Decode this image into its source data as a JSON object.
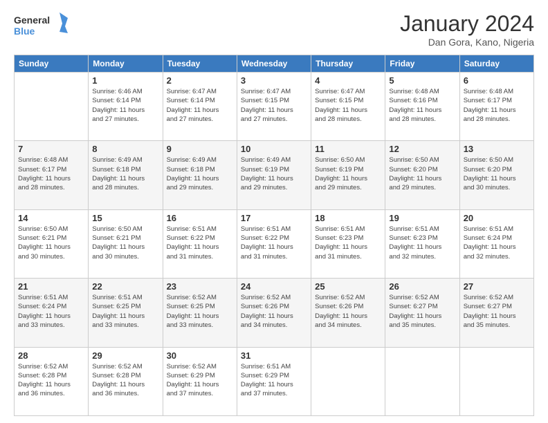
{
  "header": {
    "logo_general": "General",
    "logo_blue": "Blue",
    "month_title": "January 2024",
    "location": "Dan Gora, Kano, Nigeria"
  },
  "days_of_week": [
    "Sunday",
    "Monday",
    "Tuesday",
    "Wednesday",
    "Thursday",
    "Friday",
    "Saturday"
  ],
  "weeks": [
    [
      {
        "day": "",
        "info": ""
      },
      {
        "day": "1",
        "info": "Sunrise: 6:46 AM\nSunset: 6:14 PM\nDaylight: 11 hours\nand 27 minutes."
      },
      {
        "day": "2",
        "info": "Sunrise: 6:47 AM\nSunset: 6:14 PM\nDaylight: 11 hours\nand 27 minutes."
      },
      {
        "day": "3",
        "info": "Sunrise: 6:47 AM\nSunset: 6:15 PM\nDaylight: 11 hours\nand 27 minutes."
      },
      {
        "day": "4",
        "info": "Sunrise: 6:47 AM\nSunset: 6:15 PM\nDaylight: 11 hours\nand 28 minutes."
      },
      {
        "day": "5",
        "info": "Sunrise: 6:48 AM\nSunset: 6:16 PM\nDaylight: 11 hours\nand 28 minutes."
      },
      {
        "day": "6",
        "info": "Sunrise: 6:48 AM\nSunset: 6:17 PM\nDaylight: 11 hours\nand 28 minutes."
      }
    ],
    [
      {
        "day": "7",
        "info": "Sunrise: 6:48 AM\nSunset: 6:17 PM\nDaylight: 11 hours\nand 28 minutes."
      },
      {
        "day": "8",
        "info": "Sunrise: 6:49 AM\nSunset: 6:18 PM\nDaylight: 11 hours\nand 28 minutes."
      },
      {
        "day": "9",
        "info": "Sunrise: 6:49 AM\nSunset: 6:18 PM\nDaylight: 11 hours\nand 29 minutes."
      },
      {
        "day": "10",
        "info": "Sunrise: 6:49 AM\nSunset: 6:19 PM\nDaylight: 11 hours\nand 29 minutes."
      },
      {
        "day": "11",
        "info": "Sunrise: 6:50 AM\nSunset: 6:19 PM\nDaylight: 11 hours\nand 29 minutes."
      },
      {
        "day": "12",
        "info": "Sunrise: 6:50 AM\nSunset: 6:20 PM\nDaylight: 11 hours\nand 29 minutes."
      },
      {
        "day": "13",
        "info": "Sunrise: 6:50 AM\nSunset: 6:20 PM\nDaylight: 11 hours\nand 30 minutes."
      }
    ],
    [
      {
        "day": "14",
        "info": "Sunrise: 6:50 AM\nSunset: 6:21 PM\nDaylight: 11 hours\nand 30 minutes."
      },
      {
        "day": "15",
        "info": "Sunrise: 6:50 AM\nSunset: 6:21 PM\nDaylight: 11 hours\nand 30 minutes."
      },
      {
        "day": "16",
        "info": "Sunrise: 6:51 AM\nSunset: 6:22 PM\nDaylight: 11 hours\nand 31 minutes."
      },
      {
        "day": "17",
        "info": "Sunrise: 6:51 AM\nSunset: 6:22 PM\nDaylight: 11 hours\nand 31 minutes."
      },
      {
        "day": "18",
        "info": "Sunrise: 6:51 AM\nSunset: 6:23 PM\nDaylight: 11 hours\nand 31 minutes."
      },
      {
        "day": "19",
        "info": "Sunrise: 6:51 AM\nSunset: 6:23 PM\nDaylight: 11 hours\nand 32 minutes."
      },
      {
        "day": "20",
        "info": "Sunrise: 6:51 AM\nSunset: 6:24 PM\nDaylight: 11 hours\nand 32 minutes."
      }
    ],
    [
      {
        "day": "21",
        "info": "Sunrise: 6:51 AM\nSunset: 6:24 PM\nDaylight: 11 hours\nand 33 minutes."
      },
      {
        "day": "22",
        "info": "Sunrise: 6:51 AM\nSunset: 6:25 PM\nDaylight: 11 hours\nand 33 minutes."
      },
      {
        "day": "23",
        "info": "Sunrise: 6:52 AM\nSunset: 6:25 PM\nDaylight: 11 hours\nand 33 minutes."
      },
      {
        "day": "24",
        "info": "Sunrise: 6:52 AM\nSunset: 6:26 PM\nDaylight: 11 hours\nand 34 minutes."
      },
      {
        "day": "25",
        "info": "Sunrise: 6:52 AM\nSunset: 6:26 PM\nDaylight: 11 hours\nand 34 minutes."
      },
      {
        "day": "26",
        "info": "Sunrise: 6:52 AM\nSunset: 6:27 PM\nDaylight: 11 hours\nand 35 minutes."
      },
      {
        "day": "27",
        "info": "Sunrise: 6:52 AM\nSunset: 6:27 PM\nDaylight: 11 hours\nand 35 minutes."
      }
    ],
    [
      {
        "day": "28",
        "info": "Sunrise: 6:52 AM\nSunset: 6:28 PM\nDaylight: 11 hours\nand 36 minutes."
      },
      {
        "day": "29",
        "info": "Sunrise: 6:52 AM\nSunset: 6:28 PM\nDaylight: 11 hours\nand 36 minutes."
      },
      {
        "day": "30",
        "info": "Sunrise: 6:52 AM\nSunset: 6:29 PM\nDaylight: 11 hours\nand 37 minutes."
      },
      {
        "day": "31",
        "info": "Sunrise: 6:51 AM\nSunset: 6:29 PM\nDaylight: 11 hours\nand 37 minutes."
      },
      {
        "day": "",
        "info": ""
      },
      {
        "day": "",
        "info": ""
      },
      {
        "day": "",
        "info": ""
      }
    ]
  ]
}
